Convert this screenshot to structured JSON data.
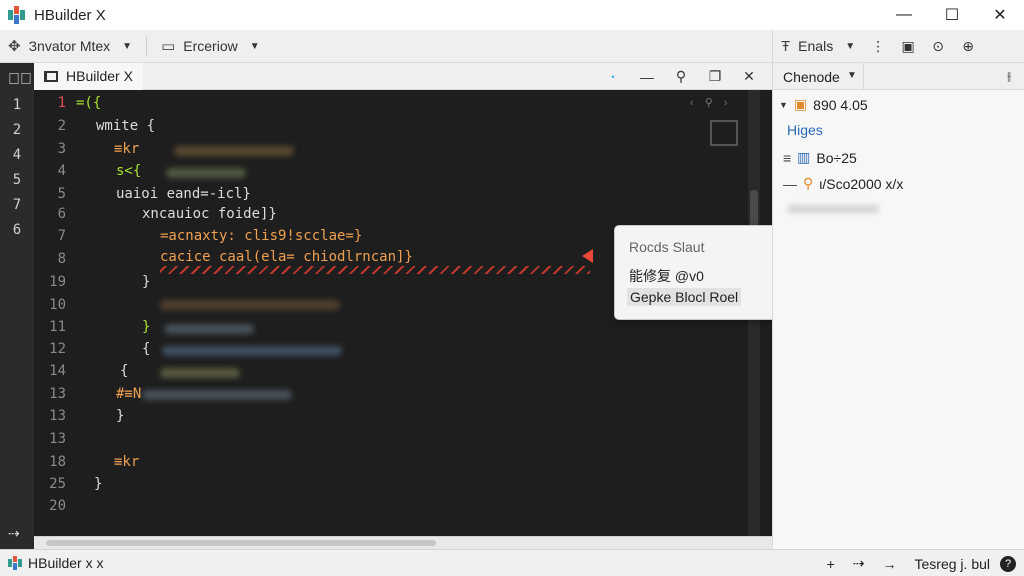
{
  "app": {
    "title": "HBuilder X"
  },
  "window_controls": {
    "minimize": "—",
    "maximize": "☐",
    "close": "✕"
  },
  "toolbar": {
    "item1": "Зnvator Mtex",
    "item2": "Erceriow"
  },
  "right_toolbar": {
    "label": "Enals"
  },
  "editor_tab": {
    "label": "HBuilder X"
  },
  "left_strip": {
    "numbers": [
      "1",
      "2",
      "4",
      "5",
      "7",
      "6"
    ]
  },
  "editor": {
    "line_numbers": [
      "1",
      "2",
      "3",
      "4",
      "5",
      "6",
      "7",
      "7",
      "8",
      "19",
      "10",
      "11",
      "12",
      "14",
      "13",
      "13",
      "13",
      "18",
      "25",
      "20"
    ],
    "code_lines": [
      "=({",
      "wmite {",
      "≡kr",
      "s<{",
      "uaioi eand=-icl}",
      "xncauioc foide]}",
      "=acnaxty: clis9!scclae=}",
      "cacice caal(ela= chiodlrncan]}",
      "}",
      "}  ",
      "{",
      "{",
      "#≡N",
      "}",
      "≡kr",
      "}"
    ]
  },
  "tooltip": {
    "title": "Rocds Slaut",
    "line2": "能修复 @v0",
    "line3": "Gepke Blocl Roel"
  },
  "right_panel": {
    "header": "Chenode",
    "row1": "890 4.05",
    "row2": "Higes",
    "row3": "Bo÷25",
    "row4": "ι/Sco2000  x/x"
  },
  "statusbar": {
    "left": "HBuilder x x",
    "right": "Tesreg j. bul",
    "help": "?"
  },
  "colors": {
    "editor_bg": "#1e1e1e",
    "error_red": "#e8493b",
    "keyword_green": "#a6e22e",
    "string_orange": "#f0a050",
    "accent_cyan": "#66d9ef"
  }
}
